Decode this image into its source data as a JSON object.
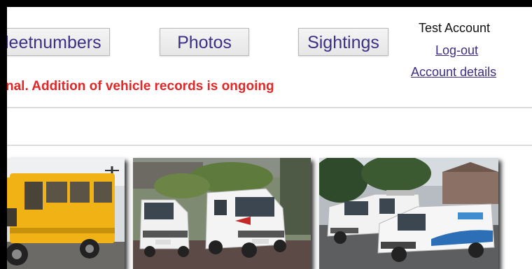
{
  "nav": {
    "fleetnumbers_label": "leetnumbers",
    "photos_label": "Photos",
    "sightings_label": "Sightings"
  },
  "account": {
    "name": "Test Account",
    "logout_label": "Log-out",
    "details_label": "Account details"
  },
  "notice": {
    "text": "nal. Addition of vehicle records is ongoing"
  },
  "photos": [
    {
      "subject": "yellow van"
    },
    {
      "subject": "white vans"
    },
    {
      "subject": "white vans on street"
    }
  ],
  "colors": {
    "link": "#3b2f86",
    "notice": "#e32727",
    "button_bg": "#ececec"
  }
}
